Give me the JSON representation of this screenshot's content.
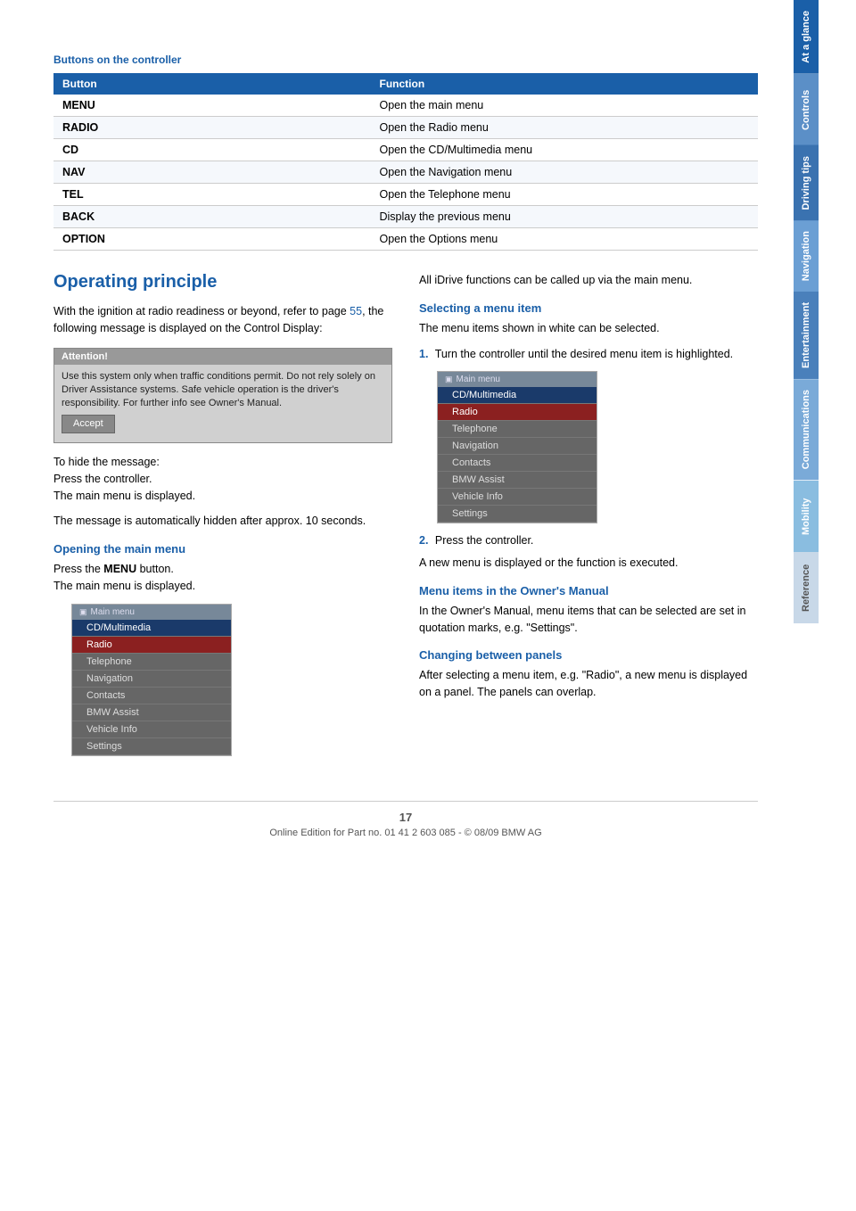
{
  "sidebar": {
    "tabs": [
      {
        "label": "At a glance",
        "color": "blue"
      },
      {
        "label": "Controls",
        "color": "light-blue"
      },
      {
        "label": "Driving tips",
        "color": "medium-blue"
      },
      {
        "label": "Navigation",
        "color": "lighter-blue"
      },
      {
        "label": "Entertainment",
        "color": "mid"
      },
      {
        "label": "Communications",
        "color": "muted"
      },
      {
        "label": "Mobility",
        "color": "light"
      },
      {
        "label": "Reference",
        "color": "reference"
      }
    ]
  },
  "section_buttons": {
    "title": "Buttons on the controller",
    "table_headers": [
      "Button",
      "Function"
    ],
    "rows": [
      {
        "button": "MENU",
        "function": "Open the main menu"
      },
      {
        "button": "RADIO",
        "function": "Open the Radio menu"
      },
      {
        "button": "CD",
        "function": "Open the CD/Multimedia menu"
      },
      {
        "button": "NAV",
        "function": "Open the Navigation menu"
      },
      {
        "button": "TEL",
        "function": "Open the Telephone menu"
      },
      {
        "button": "BACK",
        "function": "Display the previous menu"
      },
      {
        "button": "OPTION",
        "function": "Open the Options menu"
      }
    ]
  },
  "section_operating": {
    "title": "Operating principle",
    "intro": "With the ignition at radio readiness or beyond, refer to page",
    "page_ref": "55",
    "intro2": ", the following message is displayed on the Control Display:",
    "attention_header": "Attention!",
    "attention_body": "Use this system only when traffic conditions permit. Do not rely solely on Driver Assistance systems. Safe vehicle operation is the driver's responsibility. For further info see Owner's Manual.",
    "accept_label": "Accept",
    "hide_msg": "To hide the message:",
    "press_ctrl": "Press the controller.",
    "main_displayed": "The main menu is displayed.",
    "auto_hide": "The message is automatically hidden after approx. 10 seconds.",
    "opening_title": "Opening the main menu",
    "opening_text1": "Press the",
    "opening_menu_bold": "MENU",
    "opening_text2": "button.",
    "opening_text3": "The main menu is displayed.",
    "right_col_text": "All iDrive functions can be called up via the main menu.",
    "selecting_title": "Selecting a menu item",
    "selecting_text": "The menu items shown in white can be selected.",
    "step1_text": "Turn the controller until the desired menu item is highlighted.",
    "step2_text": "Press the controller.",
    "result_text": "A new menu is displayed or the function is executed.",
    "owners_manual_title": "Menu items in the Owner's Manual",
    "owners_manual_text": "In the Owner's Manual, menu items that can be selected are set in quotation marks, e.g. \"Settings\".",
    "changing_title": "Changing between panels",
    "changing_text": "After selecting a menu item, e.g. \"Radio\", a new menu is displayed on a panel. The panels can overlap.",
    "menu_header": "Main menu",
    "menu_items": [
      {
        "label": "CD/Multimedia",
        "state": "normal"
      },
      {
        "label": "Radio",
        "state": "highlighted"
      },
      {
        "label": "Telephone",
        "state": "normal"
      },
      {
        "label": "Navigation",
        "state": "normal"
      },
      {
        "label": "Contacts",
        "state": "normal"
      },
      {
        "label": "BMW Assist",
        "state": "normal"
      },
      {
        "label": "Vehicle Info",
        "state": "normal"
      },
      {
        "label": "Settings",
        "state": "normal"
      }
    ]
  },
  "footer": {
    "page_number": "17",
    "footer_text": "Online Edition for Part no. 01 41 2 603 085 - © 08/09 BMW AG"
  }
}
